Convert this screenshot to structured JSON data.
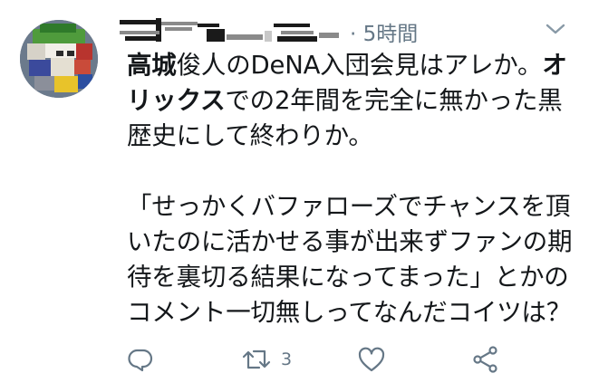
{
  "tweet": {
    "time": "5時間",
    "time_separator": "·",
    "lines": [
      {
        "bold": "高城",
        "rest": "俊人のDeNA入団会見はアレか。",
        "bold2": "オ"
      },
      {
        "bold": "リックス",
        "rest": "での2年間を完全に無かった黒"
      },
      {
        "bold": "",
        "rest": "歴史にして終わりか。"
      },
      {
        "bold": "",
        "rest": ""
      },
      {
        "bold": "",
        "rest": "「せっかくバファローズでチャンスを頂"
      },
      {
        "bold": "",
        "rest": "いたのに活かせる事が出来ずファンの期"
      },
      {
        "bold": "",
        "rest": "待を裏切る結果になってまった」とかの"
      },
      {
        "bold": "",
        "rest": "コメント一切無しってなんだコイツは？"
      }
    ]
  },
  "actions": {
    "reply_icon": "reply-icon",
    "retweet_icon": "retweet-icon",
    "retweet_count": "3",
    "like_icon": "heart-icon",
    "share_icon": "share-icon"
  },
  "colors": {
    "text": "#14171a",
    "secondary": "#657786",
    "background": "#ffffff"
  }
}
